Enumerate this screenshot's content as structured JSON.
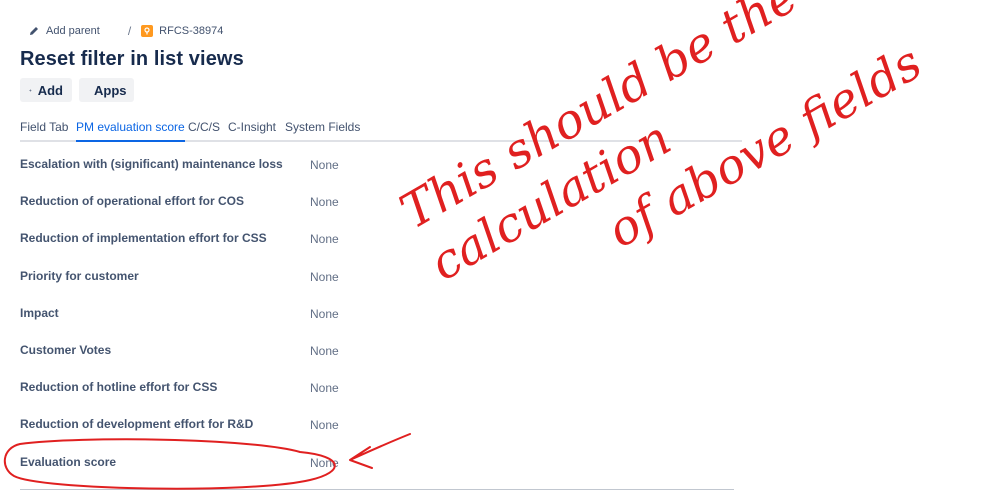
{
  "breadcrumb": {
    "add_parent": "Add parent",
    "separator": "/",
    "ticket_key": "RFCS-38974"
  },
  "page": {
    "title": "Reset filter in list views"
  },
  "actions": {
    "add_label": "Add",
    "apps_label": "Apps"
  },
  "tabs": [
    {
      "label": "Field Tab",
      "active": false
    },
    {
      "label": "PM evaluation score",
      "active": true
    },
    {
      "label": "C/C/S",
      "active": false
    },
    {
      "label": "C-Insight",
      "active": false
    },
    {
      "label": "System Fields",
      "active": false
    }
  ],
  "fields": [
    {
      "label": "Escalation with (significant) maintenance loss",
      "value": "None"
    },
    {
      "label": "Reduction of operational effort for COS",
      "value": "None"
    },
    {
      "label": "Reduction of implementation effort for CSS",
      "value": "None"
    },
    {
      "label": "Priority for customer",
      "value": "None"
    },
    {
      "label": "Impact",
      "value": "None"
    },
    {
      "label": "Customer Votes",
      "value": "None"
    },
    {
      "label": "Reduction of hotline effort for CSS",
      "value": "None"
    },
    {
      "label": "Reduction of development effort for R&D",
      "value": "None"
    },
    {
      "label": "Evaluation score",
      "value": "None"
    }
  ],
  "annotation": {
    "color": "#e02020",
    "line1": "This should be the calculation",
    "line2": "of above fields"
  },
  "colors": {
    "accent": "#0c66e4",
    "ticket_icon": "#ff991f"
  }
}
